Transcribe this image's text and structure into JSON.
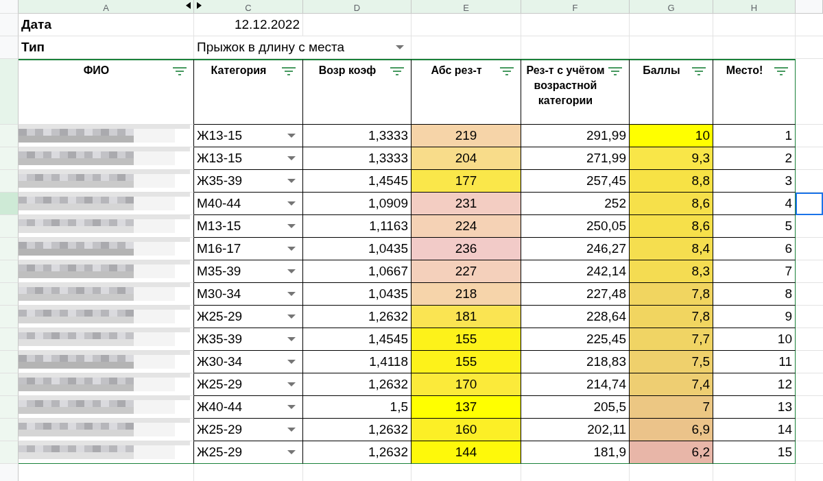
{
  "column_headers": [
    "A",
    "C",
    "D",
    "E",
    "F",
    "G",
    "H"
  ],
  "fields": [
    {
      "label": "Дата",
      "value": "12.12.2022",
      "kind": "text"
    },
    {
      "label": "Тип",
      "value": "Прыжок в длину с места",
      "kind": "dropdown"
    }
  ],
  "table": {
    "columns": [
      "ФИО",
      "Категория",
      "Возр коэф",
      "Абс рез-т",
      "Рез-т с учётом возрастной категории",
      "Баллы",
      "Место!"
    ],
    "rows": [
      {
        "category": "Ж13-15",
        "coef": "1,3333",
        "abs": {
          "value": "219",
          "color": "#f6d4a8"
        },
        "adjusted": "291,99",
        "points": {
          "value": "10",
          "color": "#ffff00"
        },
        "place": "1",
        "selected": false
      },
      {
        "category": "Ж13-15",
        "coef": "1,3333",
        "abs": {
          "value": "204",
          "color": "#f8dc8a"
        },
        "adjusted": "271,99",
        "points": {
          "value": "9,3",
          "color": "#f9e648"
        },
        "place": "2",
        "selected": false
      },
      {
        "category": "Ж35-39",
        "coef": "1,4545",
        "abs": {
          "value": "177",
          "color": "#fae74a"
        },
        "adjusted": "257,45",
        "points": {
          "value": "8,8",
          "color": "#f7e245"
        },
        "place": "3",
        "selected": false
      },
      {
        "category": "М40-44",
        "coef": "1,0909",
        "abs": {
          "value": "231",
          "color": "#f3cdc2"
        },
        "adjusted": "252",
        "points": {
          "value": "8,6",
          "color": "#f6e04a"
        },
        "place": "4",
        "selected": true
      },
      {
        "category": "М13-15",
        "coef": "1,1163",
        "abs": {
          "value": "224",
          "color": "#f5d2b5"
        },
        "adjusted": "250,05",
        "points": {
          "value": "8,6",
          "color": "#f6e04a"
        },
        "place": "5",
        "selected": false
      },
      {
        "category": "М16-17",
        "coef": "1,0435",
        "abs": {
          "value": "236",
          "color": "#f2cbc8"
        },
        "adjusted": "246,27",
        "points": {
          "value": "8,4",
          "color": "#f5de4f"
        },
        "place": "6",
        "selected": false
      },
      {
        "category": "М35-39",
        "coef": "1,0667",
        "abs": {
          "value": "227",
          "color": "#f4d0bb"
        },
        "adjusted": "242,14",
        "points": {
          "value": "8,3",
          "color": "#f4dc52"
        },
        "place": "7",
        "selected": false
      },
      {
        "category": "М30-34",
        "coef": "1,0435",
        "abs": {
          "value": "218",
          "color": "#f6d4aa"
        },
        "adjusted": "227,48",
        "points": {
          "value": "7,8",
          "color": "#f1d560"
        },
        "place": "8",
        "selected": false
      },
      {
        "category": "Ж25-29",
        "coef": "1,2632",
        "abs": {
          "value": "181",
          "color": "#fae452"
        },
        "adjusted": "228,64",
        "points": {
          "value": "7,8",
          "color": "#f1d560"
        },
        "place": "9",
        "selected": false
      },
      {
        "category": "Ж35-39",
        "coef": "1,4545",
        "abs": {
          "value": "155",
          "color": "#fdf21a"
        },
        "adjusted": "225,45",
        "points": {
          "value": "7,7",
          "color": "#f0d464"
        },
        "place": "10",
        "selected": false
      },
      {
        "category": "Ж30-34",
        "coef": "1,4118",
        "abs": {
          "value": "155",
          "color": "#fdf21a"
        },
        "adjusted": "218,83",
        "points": {
          "value": "7,5",
          "color": "#efd06c"
        },
        "place": "11",
        "selected": false
      },
      {
        "category": "Ж25-29",
        "coef": "1,2632",
        "abs": {
          "value": "170",
          "color": "#fbea3a"
        },
        "adjusted": "214,74",
        "points": {
          "value": "7,4",
          "color": "#eece72"
        },
        "place": "12",
        "selected": false
      },
      {
        "category": "Ж40-44",
        "coef": "1,5",
        "abs": {
          "value": "137",
          "color": "#ffff00"
        },
        "adjusted": "205,5",
        "points": {
          "value": "7",
          "color": "#ecc783"
        },
        "place": "13",
        "selected": false
      },
      {
        "category": "Ж25-29",
        "coef": "1,2632",
        "abs": {
          "value": "160",
          "color": "#fcef26"
        },
        "adjusted": "202,11",
        "points": {
          "value": "6,9",
          "color": "#ebc38a"
        },
        "place": "14",
        "selected": false
      },
      {
        "category": "Ж25-29",
        "coef": "1,2632",
        "abs": {
          "value": "144",
          "color": "#fef90a"
        },
        "adjusted": "181,9",
        "points": {
          "value": "6,2",
          "color": "#e8b6a8"
        },
        "place": "15",
        "selected": false
      }
    ]
  }
}
